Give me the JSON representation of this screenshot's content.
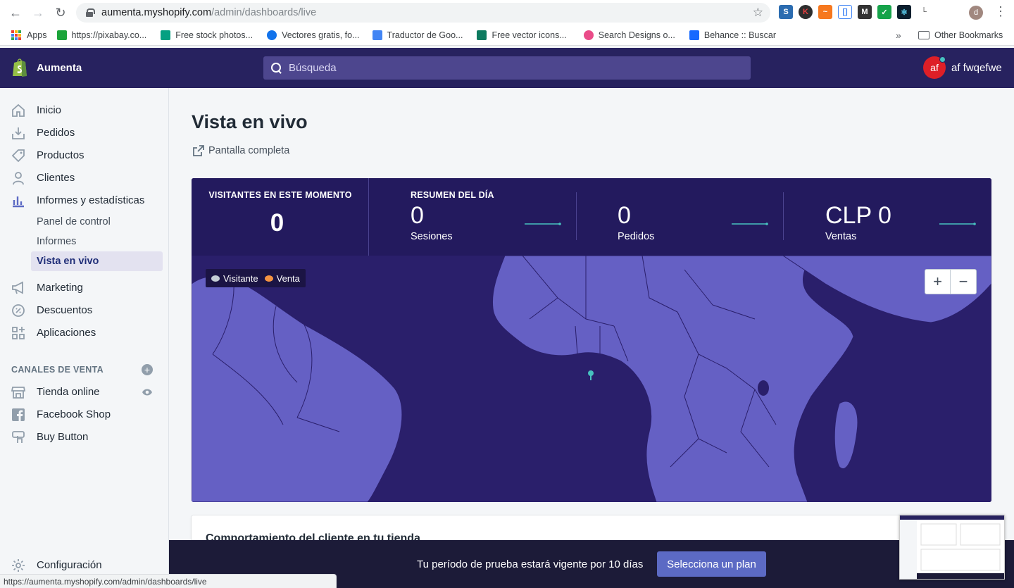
{
  "browser": {
    "url_host": "aumenta.myshopify.com",
    "url_path": "/admin/dashboards/live",
    "profile_initial": "d",
    "status_url": "https://aumenta.myshopify.com/admin/dashboards/live"
  },
  "bookmarks": {
    "items": [
      "Apps",
      "https://pixabay.co...",
      "Free stock photos...",
      "Vectores gratis, fo...",
      "Traductor de Goo...",
      "Free vector icons...",
      "Search Designs o...",
      "Behance :: Buscar"
    ],
    "other": "Other Bookmarks"
  },
  "topbar": {
    "store": "Aumenta",
    "search_placeholder": "Búsqueda",
    "user_initials": "af",
    "user_name": "af fwqefwe"
  },
  "sidebar": {
    "items": [
      "Inicio",
      "Pedidos",
      "Productos",
      "Clientes",
      "Informes y estadísticas"
    ],
    "sub_items": [
      "Panel de control",
      "Informes",
      "Vista en vivo"
    ],
    "items2": [
      "Marketing",
      "Descuentos",
      "Aplicaciones"
    ],
    "channels_title": "CANALES DE VENTA",
    "channels": [
      "Tienda online",
      "Facebook Shop",
      "Buy Button"
    ],
    "settings": "Configuración"
  },
  "main": {
    "title": "Vista en vivo",
    "fullscreen": "Pantalla completa"
  },
  "live": {
    "visitors_title": "VISITANTES EN ESTE MOMENTO",
    "visitors_value": "0",
    "summary_title": "RESUMEN DEL DÍA",
    "metrics": [
      {
        "value": "0",
        "name": "Sesiones"
      },
      {
        "value": "0",
        "name": "Pedidos"
      },
      {
        "value": "CLP 0",
        "name": "Ventas"
      }
    ],
    "legend_visitor": "Visitante",
    "legend_sale": "Venta",
    "zoom_in": "+",
    "zoom_out": "−"
  },
  "behavior_title": "Comportamiento del cliente en tu tienda",
  "trial": {
    "text": "Tu período de prueba estará vigente por 10 días",
    "button": "Selecciona un plan"
  },
  "colors": {
    "topbar": "#27225f",
    "map_ocean": "#2a1f6b",
    "map_land": "#6560c4",
    "accent": "#5c6ac4",
    "sparkline": "#47c1bf"
  }
}
